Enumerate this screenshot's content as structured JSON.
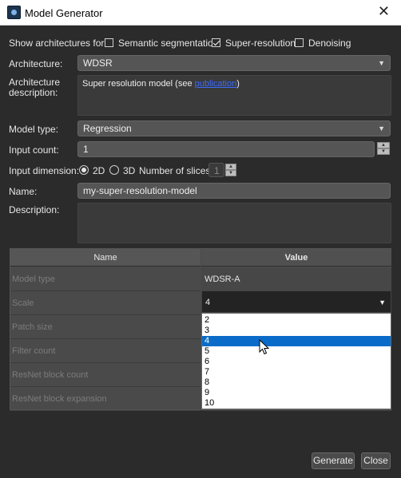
{
  "window": {
    "title": "Model Generator",
    "close_symbol": "✕"
  },
  "filter": {
    "label": "Show architectures for:",
    "options": [
      {
        "label": "Semantic segmentation",
        "checked": false
      },
      {
        "label": "Super-resolution",
        "checked": true
      },
      {
        "label": "Denoising",
        "checked": false
      }
    ]
  },
  "architecture": {
    "label": "Architecture:",
    "value": "WDSR"
  },
  "arch_description": {
    "label_line1": "Architecture",
    "label_line2": "description:",
    "text_prefix": "Super resolution model (see ",
    "link_text": "publication",
    "text_suffix": ")"
  },
  "model_type": {
    "label": "Model type:",
    "value": "Regression"
  },
  "input_count": {
    "label": "Input count:",
    "value": "1"
  },
  "input_dimension": {
    "label": "Input dimension:",
    "opt_2d": "2D",
    "opt_3d": "3D",
    "selected": "2D",
    "slices_label": "Number of slices:",
    "slices_value": "1"
  },
  "name": {
    "label": "Name:",
    "value": "my-super-resolution-model"
  },
  "description": {
    "label": "Description:",
    "value": ""
  },
  "params_table": {
    "headers": [
      "Name",
      "Value"
    ],
    "rows": [
      {
        "name": "Model type",
        "value": "WDSR-A"
      },
      {
        "name": "Scale",
        "value": "4"
      },
      {
        "name": "Patch size",
        "value": ""
      },
      {
        "name": "Filter count",
        "value": ""
      },
      {
        "name": "ResNet block count",
        "value": ""
      },
      {
        "name": "ResNet block expansion",
        "value": ""
      }
    ]
  },
  "scale_dropdown": {
    "options": [
      "2",
      "3",
      "4",
      "5",
      "6",
      "7",
      "8",
      "9",
      "10"
    ],
    "selected": "4"
  },
  "buttons": {
    "generate": "Generate",
    "close": "Close"
  },
  "colors": {
    "background": "#2b2b2b",
    "selection": "#0a6cc8",
    "link": "#3b6cff"
  }
}
